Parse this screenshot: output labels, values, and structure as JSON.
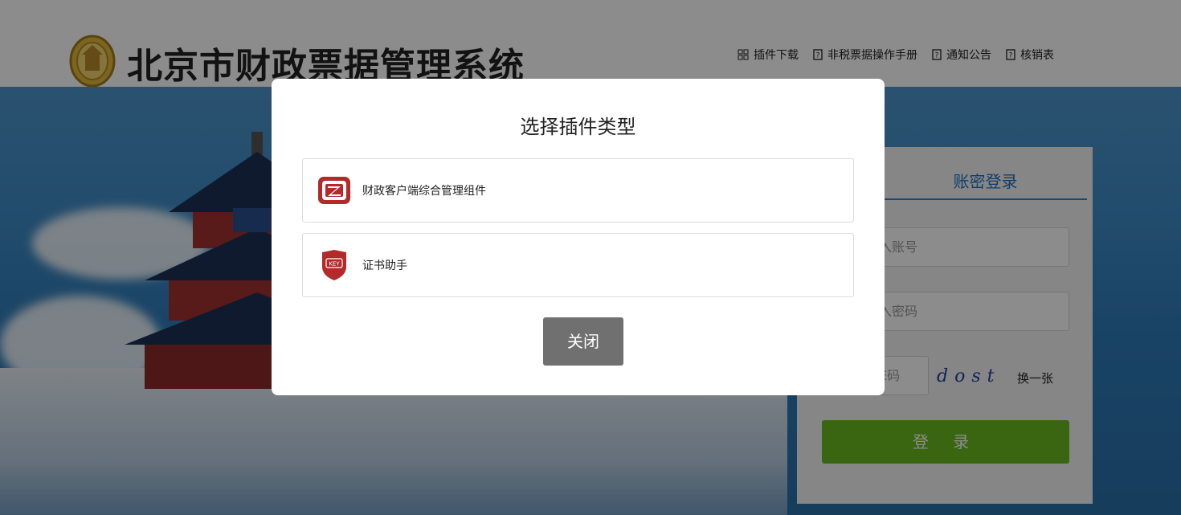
{
  "header": {
    "site_title": "北京市财政票据管理系统",
    "nav": [
      {
        "label": "插件下载",
        "icon": "grid-icon"
      },
      {
        "label": "非税票据操作手册",
        "icon": "help-doc-icon"
      },
      {
        "label": "通知公告",
        "icon": "help-doc-icon"
      },
      {
        "label": "核销表",
        "icon": "help-doc-icon"
      }
    ]
  },
  "login": {
    "tab_label": "账密登录",
    "account_placeholder": "入账号",
    "password_placeholder": "入密码",
    "captcha_placeholder": "E码",
    "captcha_text": "dost",
    "refresh_label": "换一张",
    "submit_label": "登 录"
  },
  "modal": {
    "title": "选择插件类型",
    "options": [
      {
        "label": "财政客户端综合管理组件",
        "icon": "ez-client-icon"
      },
      {
        "label": "证书助手",
        "icon": "key-shield-icon"
      }
    ],
    "close_label": "关闭"
  },
  "colors": {
    "accent_blue": "#2b86d3",
    "login_green": "#6ab81f",
    "close_gray": "#707070",
    "icon_red": "#b22a2a"
  }
}
